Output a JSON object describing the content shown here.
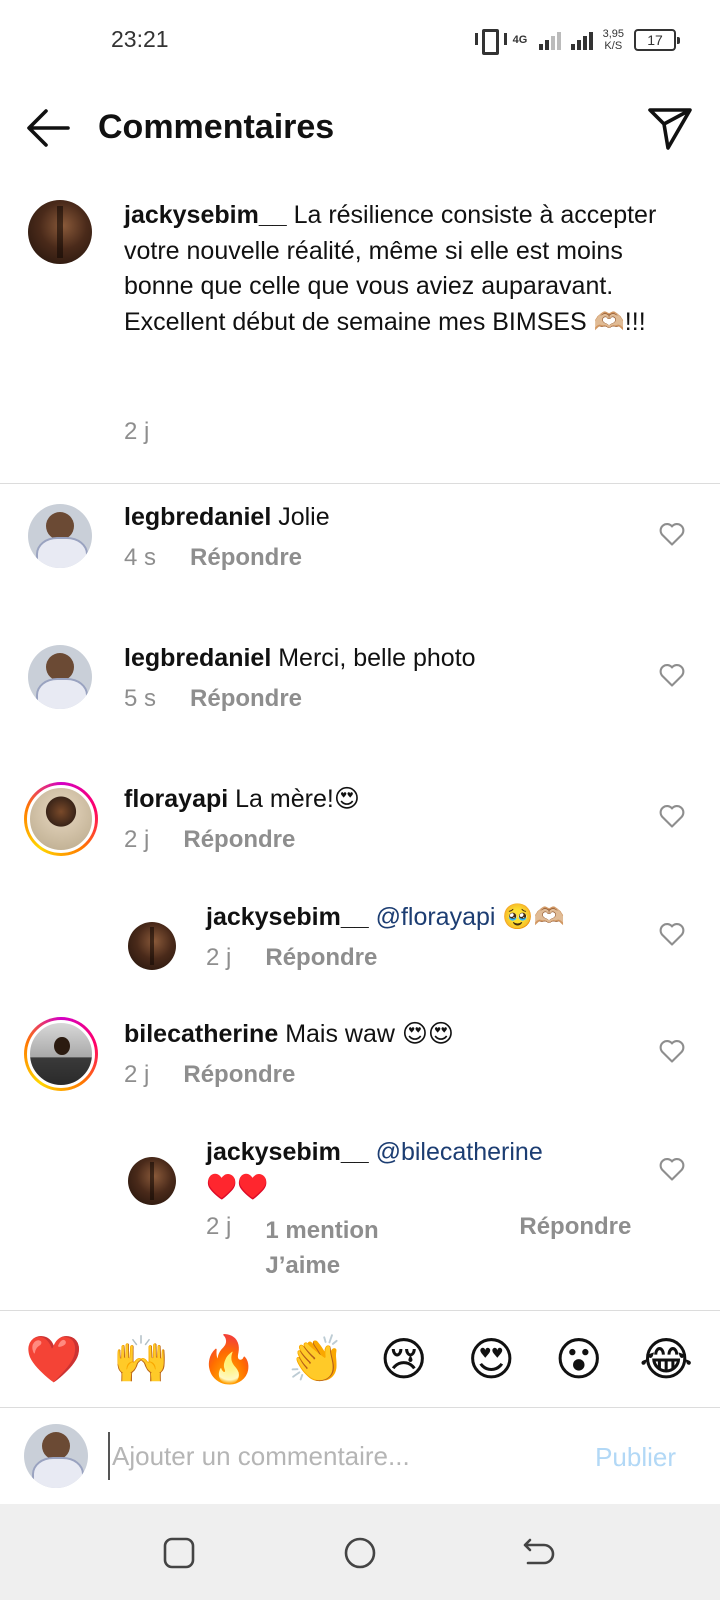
{
  "status_bar": {
    "time": "23:21",
    "network": "4G",
    "speed_value": "3,95",
    "speed_unit": "K/S",
    "battery": "17"
  },
  "header": {
    "title": "Commentaires",
    "back_icon": "arrow-left-icon",
    "share_icon": "paper-plane-icon"
  },
  "caption": {
    "username": "jackysebim__",
    "lines": [
      "La résilience consiste à accepter votre nouvelle réalité, même si elle est moins bonne que celle que vous aviez auparavant.",
      "Excellent début de semaine mes BIMSES 🫶🏼!!!"
    ],
    "time": "2 j"
  },
  "comments": [
    {
      "username": "legbredaniel",
      "text": "Jolie",
      "time": "4 s",
      "reply": "Répondre"
    },
    {
      "username": "legbredaniel",
      "text": "Merci, belle photo",
      "time": "5 s",
      "reply": "Répondre"
    },
    {
      "username": "florayapi",
      "text": "La mère!😍",
      "time": "2 j",
      "reply": "Répondre"
    },
    {
      "username": "jackysebim__",
      "mention": "@florayapi",
      "text": "🥹🫶🏼",
      "time": "2 j",
      "reply": "Répondre"
    },
    {
      "username": "bilecatherine",
      "text": "Mais waw 😍😍",
      "time": "2 j",
      "reply": "Répondre"
    },
    {
      "username": "jackysebim__",
      "mention": "@bilecatherine",
      "text": "♥️♥️",
      "time": "2 j",
      "likes": "1 mention J’aime",
      "reply": "Répondre"
    }
  ],
  "reactions": [
    "❤️",
    "🙌",
    "🔥",
    "👏",
    "😢",
    "😍",
    "😮",
    "😂"
  ],
  "composer": {
    "placeholder": "Ajouter un commentaire...",
    "publish": "Publier"
  },
  "colors": {
    "accent_publish": "#b2d8f6",
    "mention": "#1c3d72",
    "meta_text": "#8e8e8e"
  }
}
